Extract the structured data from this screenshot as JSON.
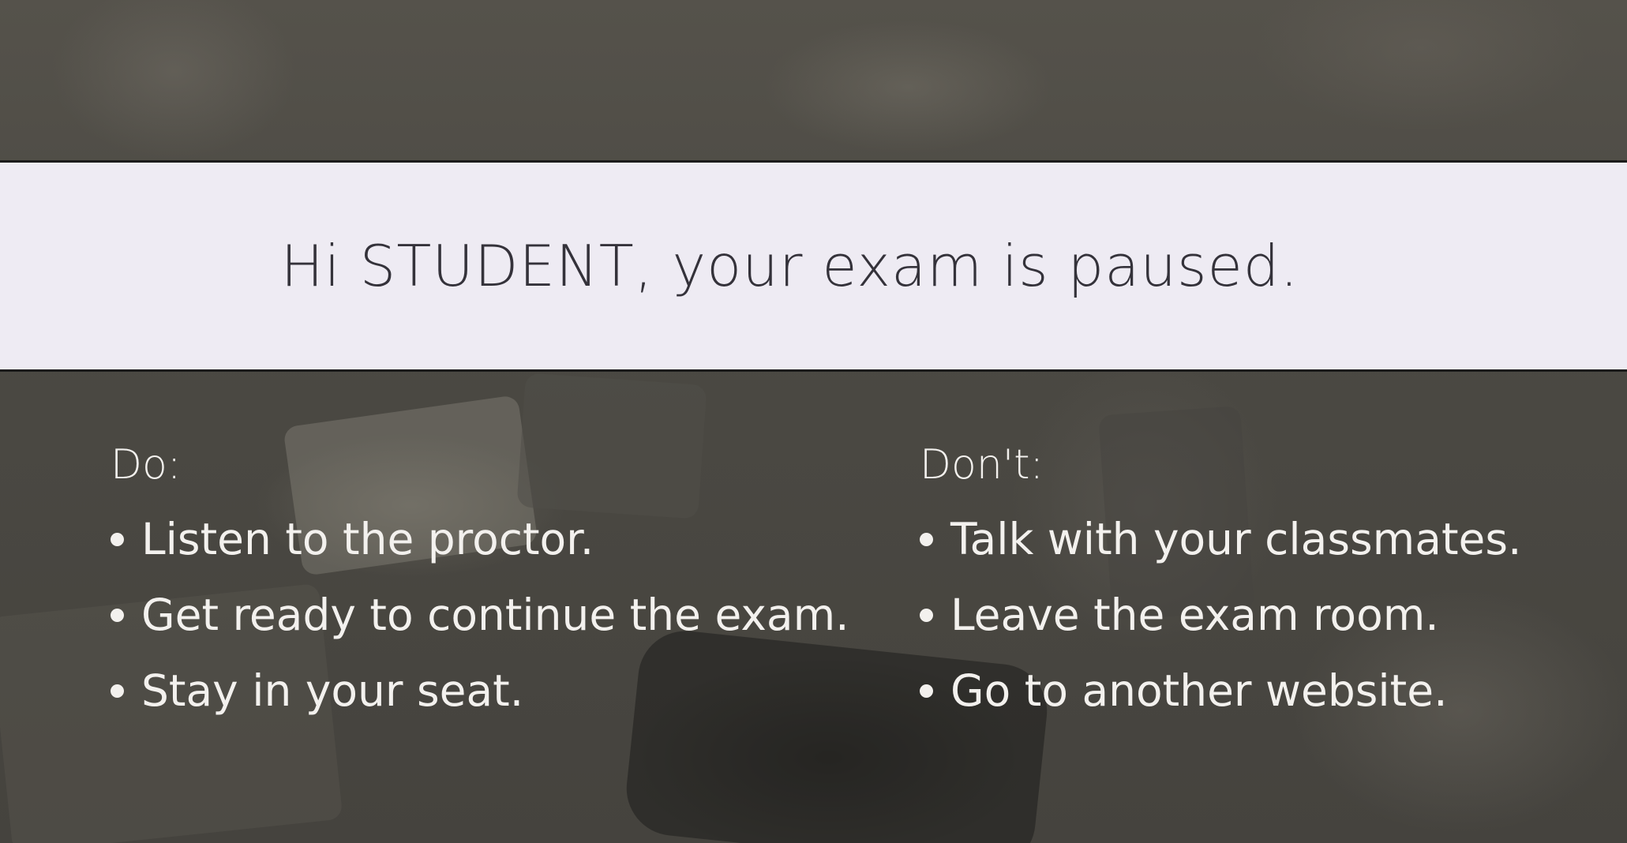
{
  "banner": {
    "message": "Hi STUDENT, your exam is paused."
  },
  "do_section": {
    "heading": "Do:",
    "items": [
      "Listen to the proctor.",
      "Get ready to continue the exam.",
      "Stay in your seat."
    ]
  },
  "dont_section": {
    "heading": "Don't:",
    "items": [
      "Talk with your classmates.",
      "Leave the exam room.",
      "Go to another website."
    ]
  },
  "colors": {
    "banner_background": "#eeebf3",
    "banner_text": "#34323a",
    "overlay_background": "#4a4842",
    "list_text": "#f3f1ee"
  }
}
